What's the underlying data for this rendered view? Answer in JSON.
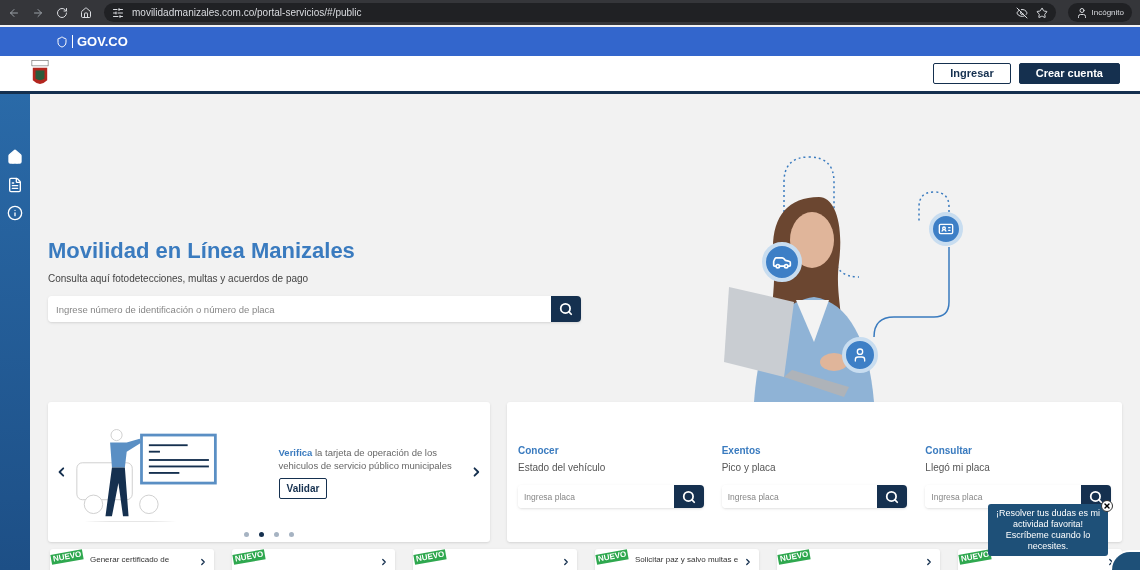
{
  "browser": {
    "url": "movilidadmanizales.com.co/portal-servicios/#/public",
    "profile": "Incógnito"
  },
  "gov_bar": {
    "label": "GOV.CO"
  },
  "header": {
    "buttons": [
      {
        "label": "Ingresar",
        "kind": "outline"
      },
      {
        "label": "Crear cuenta",
        "kind": "solid"
      }
    ]
  },
  "sidebar": {
    "items": [
      {
        "kind": "home"
      },
      {
        "kind": "document"
      },
      {
        "kind": "info"
      }
    ]
  },
  "hero": {
    "title": "Movilidad en Línea Manizales",
    "subtitle": "Consulta aquí fotodetecciones, multas y acuerdos de pago",
    "search": {
      "placeholder": "Ingrese número de identificación o número de placa"
    }
  },
  "carousel": {
    "text": "**Verifica** la tarjeta de operación de los vehiculos de servicio público municipales",
    "button": "Validar",
    "dots": [
      {
        "selected": false
      },
      {
        "selected": true
      },
      {
        "selected": false
      },
      {
        "selected": false
      }
    ]
  },
  "queries": [
    {
      "title": "Conocer",
      "subtitle": "Estado del vehículo",
      "placeholder": "Ingresa placa"
    },
    {
      "title": "Exentos",
      "subtitle": "Pico y placa",
      "placeholder": "Ingresa placa"
    },
    {
      "title": "Consultar",
      "subtitle": "Llegó mi placa",
      "placeholder": "Ingresa placa"
    }
  ],
  "services": [
    {
      "badge": "NUEVO",
      "title": "Generar certificado de"
    },
    {
      "badge": "NUEVO"
    },
    {
      "badge": "NUEVO"
    },
    {
      "badge": "NUEVO",
      "title": "Solicitar paz y salvo multas e"
    },
    {
      "badge": "NUEVO"
    },
    {
      "badge": "NUEVO"
    }
  ],
  "chat": {
    "message": "¡Resolver tus dudas es mi actividad favorita! Escríbeme cuando lo necesites."
  }
}
